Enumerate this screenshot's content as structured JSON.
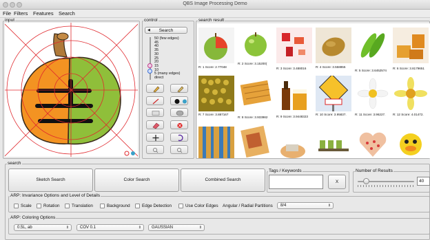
{
  "window": {
    "title": "QBS Image Processing Demo"
  },
  "menu": {
    "items": [
      "File",
      "Filters",
      "Features",
      "Search"
    ]
  },
  "input_panel": {
    "label": "input"
  },
  "control_panel": {
    "label": "control",
    "search_button": "Search",
    "slider_ticks": [
      "50 (few edges)",
      "45",
      "40",
      "35",
      "30",
      "25",
      "20",
      "15",
      "10",
      "5 (many edges)",
      "direct"
    ],
    "tools": [
      "pencil-icon",
      "pencil-alt-icon",
      "line-icon",
      "dot-icon",
      "rectangle-icon",
      "oval-icon",
      "eraser-icon",
      "clear-icon",
      "move-icon",
      "undo-icon",
      "zoom-out-icon",
      "zoom-in-icon"
    ]
  },
  "results_panel": {
    "label": "search result",
    "rows": [
      [
        "R: 1 Score: 2.77048",
        "R: 2 Score: 3.15200(",
        "R: 3 Score: 3.488016",
        "R: 4 Score: 3.558855",
        "R: 5 Score: 3.6452574",
        "R: 6 Score: 3.8179651"
      ],
      [
        "R: 7 Score: 3.887167",
        "R: 8 Score: 3.933982",
        "R: 9 Score: 3.9448323",
        "R: 10 Score: 3.95837.",
        "R: 11 Score: 3.96227.",
        "R: 12 Score: 4.01472."
      ],
      [
        "",
        "",
        "",
        "",
        "",
        ""
      ]
    ]
  },
  "search_section": {
    "label": "search",
    "sketch_button": "Sketch Search",
    "color_button": "Color Search",
    "combined_button": "Combined Search"
  },
  "tags": {
    "label": "Tags / Keywords",
    "value": "",
    "clear_button": "X"
  },
  "num_results": {
    "label": "Number of Results",
    "value": "40",
    "slider_fraction": 0.15
  },
  "arp": {
    "label": "ARP: Invariance Options and Level of Details",
    "options": [
      "Scale",
      "Rotation",
      "Translation",
      "Background",
      "Edge Detection",
      "Use Color Edges"
    ],
    "partitions_label": "Angular / Radial Partitions",
    "partitions_value": "8/4"
  },
  "coloring": {
    "label": "ARP: Coloring Options",
    "select1": "0.5L, ab",
    "select2": "COV 0.1",
    "select3": "GAUSSIAN"
  },
  "colors": {
    "accent": "#3b6fd8",
    "grid_red": "#e0282d",
    "orange": "#f39322",
    "green": "#8fbf3a"
  }
}
